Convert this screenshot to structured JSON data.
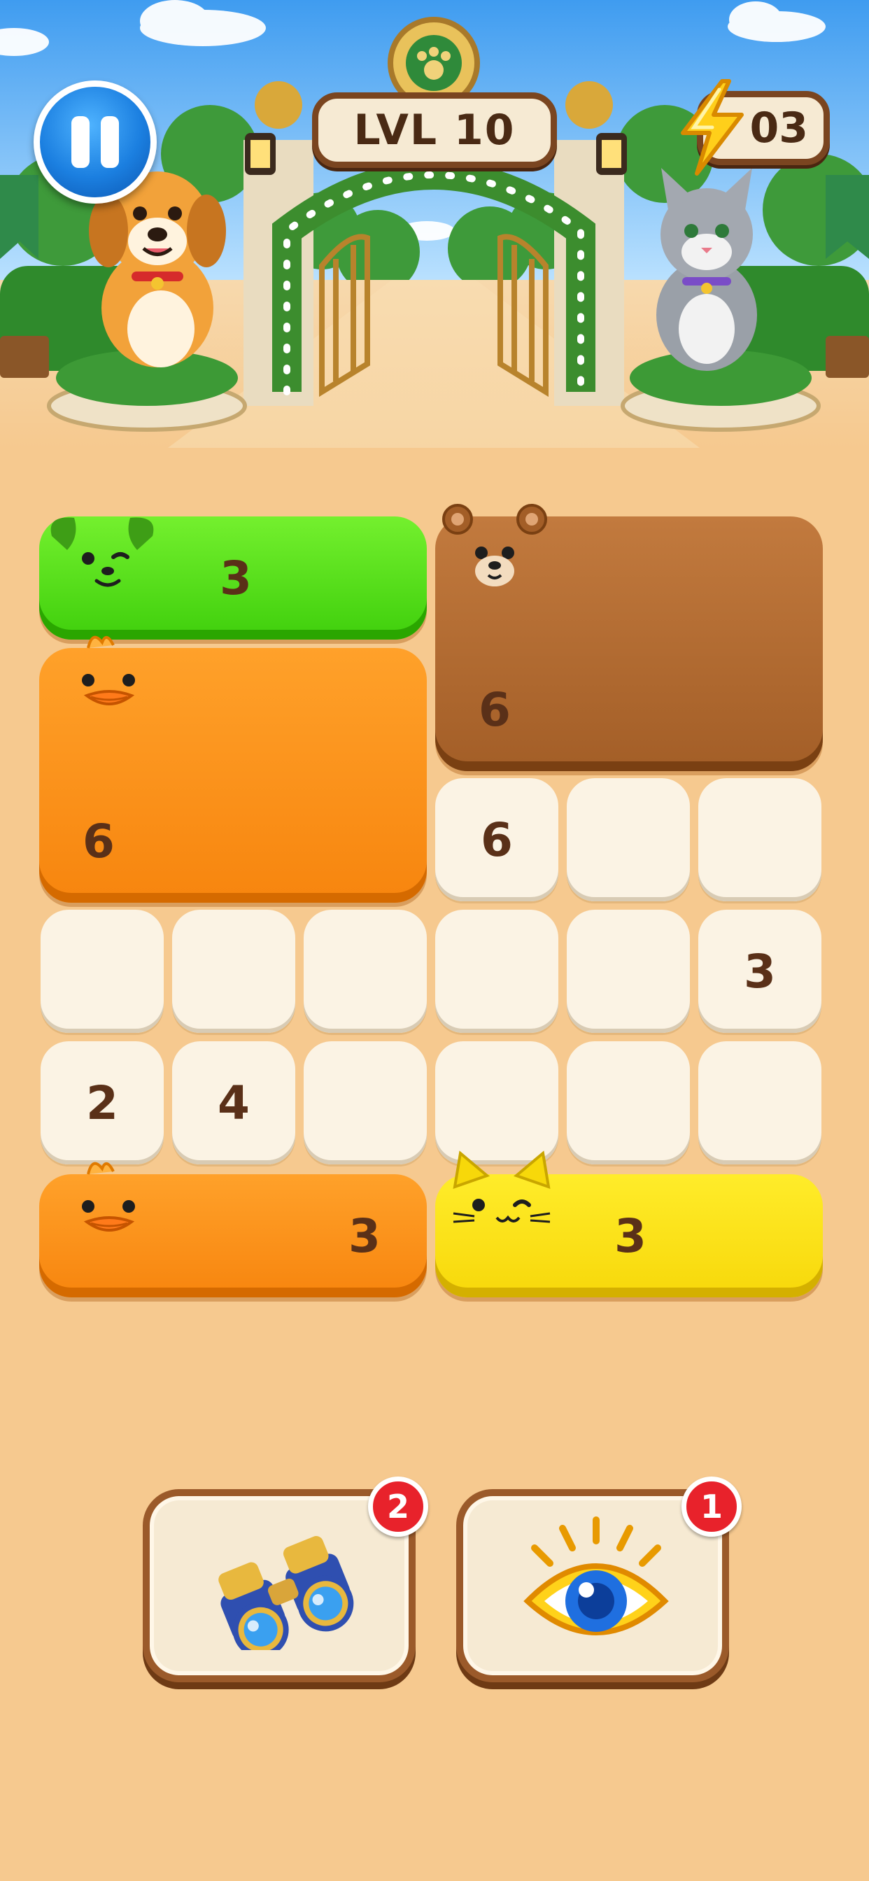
{
  "header": {
    "level_label": "LVL 10",
    "energy_count": "03",
    "pause_icon": "pause-icon",
    "energy_icon": "lightning-bolt-icon"
  },
  "board": {
    "grid": {
      "columns": 6,
      "rows": 6
    },
    "blocks": [
      {
        "animal": "dog",
        "color": "#52dc12",
        "number": "3"
      },
      {
        "animal": "bear",
        "color": "#b06a30",
        "number": "6"
      },
      {
        "animal": "duck",
        "color": "#f98e15",
        "number": "6"
      },
      {
        "animal": "duck",
        "color": "#f98e15",
        "number": "3"
      },
      {
        "animal": "cat",
        "color": "#fbe010",
        "number": "3"
      }
    ],
    "cells": [
      {
        "number": "6"
      },
      {
        "number": ""
      },
      {
        "number": ""
      },
      {
        "number": ""
      },
      {
        "number": ""
      },
      {
        "number": ""
      },
      {
        "number": ""
      },
      {
        "number": ""
      },
      {
        "number": "3"
      },
      {
        "number": "2"
      },
      {
        "number": "4"
      },
      {
        "number": ""
      },
      {
        "number": ""
      },
      {
        "number": ""
      },
      {
        "number": ""
      }
    ]
  },
  "boosters": [
    {
      "name": "binoculars",
      "icon": "binoculars-icon",
      "count": "2"
    },
    {
      "name": "eye",
      "icon": "eye-icon",
      "count": "1"
    }
  ],
  "colors": {
    "background": "#f6c98f",
    "cell": "#fbf3e4",
    "badge": "#e8222b",
    "pause_button": "#1b7fe0"
  }
}
